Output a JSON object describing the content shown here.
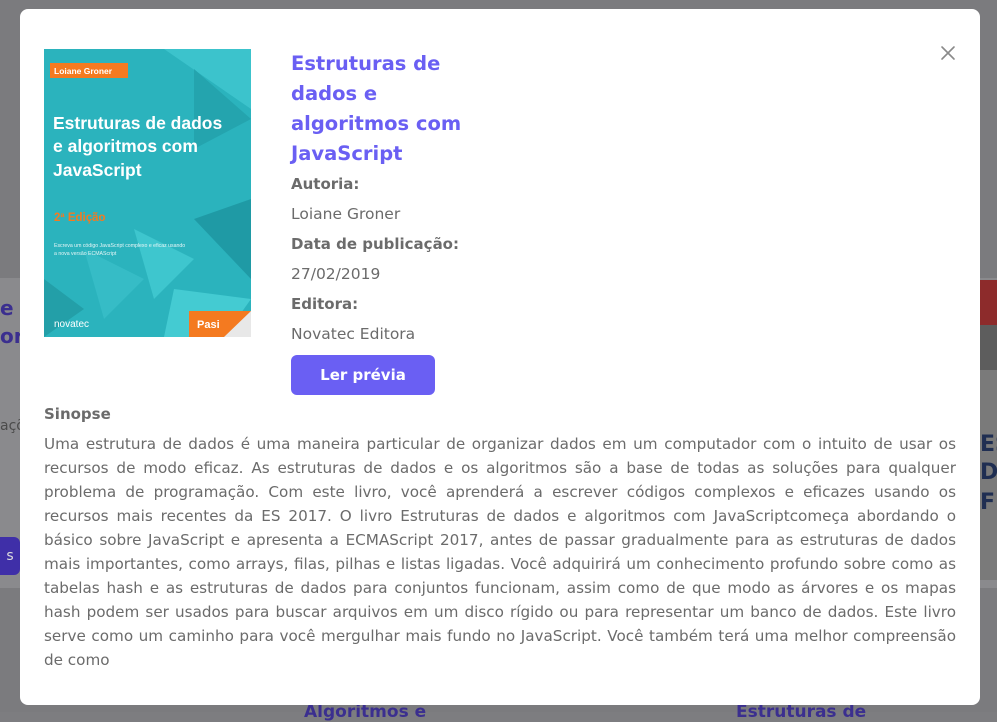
{
  "book": {
    "title": "Estruturas de dados e algoritmos com JavaScript",
    "authorship_label": "Autoria:",
    "author": "Loiane Groner",
    "pubdate_label": "Data de publicação:",
    "pubdate": "27/02/2019",
    "publisher_label": "Editora:",
    "publisher": "Novatec Editora",
    "preview_button": "Ler prévia",
    "synopsis_label": "Sinopse",
    "synopsis": "Uma estrutura de dados é uma maneira particular de organizar dados em um computador com o intuito de usar os recursos de modo eficaz. As estruturas de dados e os algoritmos são a base de todas as soluções para qualquer problema de programação. Com este livro, você aprenderá a escrever códigos complexos e eficazes usando os recursos mais recentes da ES 2017. O livro Estruturas de dados e algoritmos com JavaScriptcomeça abordando o básico sobre JavaScript e apresenta a ECMAScript 2017, antes de passar gradualmente para as estruturas de dados mais importantes, como arrays, filas, pilhas e listas ligadas. Você adquirirá um conhecimento profundo sobre como as tabelas hash e as estruturas de dados para conjuntos funcionam, assim como de que modo as árvores e os mapas hash podem ser usados para buscar arquivos em um disco rígido ou para representar um banco de dados. Este livro serve como um caminho para você mergulhar mais fundo no JavaScript. Você também terá uma melhor compreensão de como"
  },
  "cover": {
    "author_tag": "Loiane Groner",
    "title_lines": [
      "Estruturas de dados",
      "e algoritmos com",
      "JavaScript"
    ],
    "edition": "2ª Edição",
    "subtitle_lines": [
      "Escreva um código JavaScript complexo e eficaz usando",
      "a nova versão ECMAScript"
    ],
    "publisher_logo": "novatec",
    "corner_badge": "Pasi"
  },
  "background": {
    "left_fragments": [
      "e",
      "ori"
    ],
    "left_small": "açõ",
    "left_button": "s",
    "right_fragments": [
      "ES",
      "D",
      "FU"
    ],
    "bottom_titles": [
      "Algoritmos e",
      "Estruturas de"
    ]
  },
  "icons": {
    "close": "close-icon"
  },
  "colors": {
    "accent": "#6a5ff3",
    "text": "#6b6b6b",
    "cover_teal": "#2bb3bd",
    "cover_orange": "#f47a20"
  }
}
